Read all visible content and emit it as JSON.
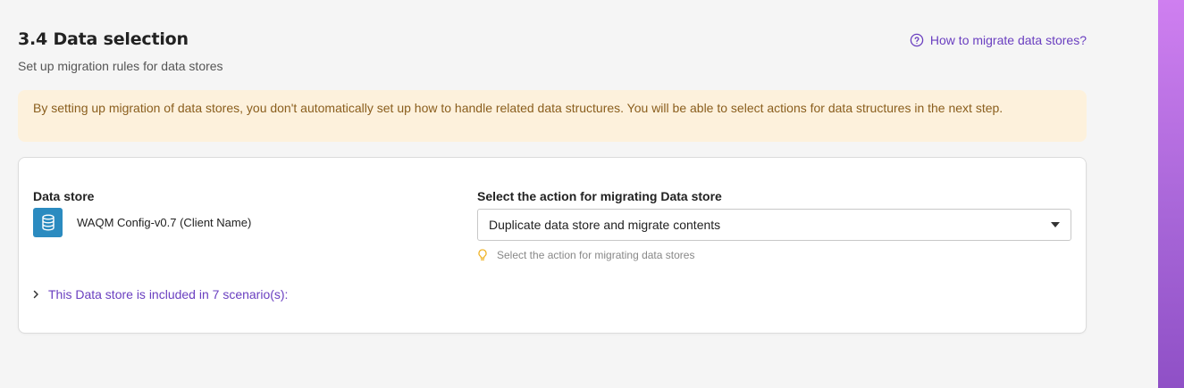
{
  "section": {
    "title": "3.4 Data selection",
    "subtitle": "Set up migration rules for data stores",
    "help_link": "How to migrate data stores?"
  },
  "notice": {
    "text": "By setting up migration of data stores, you don't automatically set up how to handle related data structures. You will be able to select actions for data structures in the next step."
  },
  "card": {
    "store_label": "Data store",
    "store_name": "WAQM Config-v0.7 (Client Name)",
    "store_icon": "database-icon",
    "action_label": "Select the action for migrating Data store",
    "action_selected": "Duplicate data store and migrate contents",
    "hint": "Select the action for migrating data stores",
    "hint_icon": "lightbulb-icon",
    "scenarios_toggle": "This Data store is included in 7 scenario(s):"
  },
  "colors": {
    "accent": "#6a3fc0",
    "notice_bg": "#fdf1dc",
    "notice_text": "#8a5e1d",
    "store_icon_bg": "#2b8bc0",
    "hint_icon": "#f0b429"
  }
}
